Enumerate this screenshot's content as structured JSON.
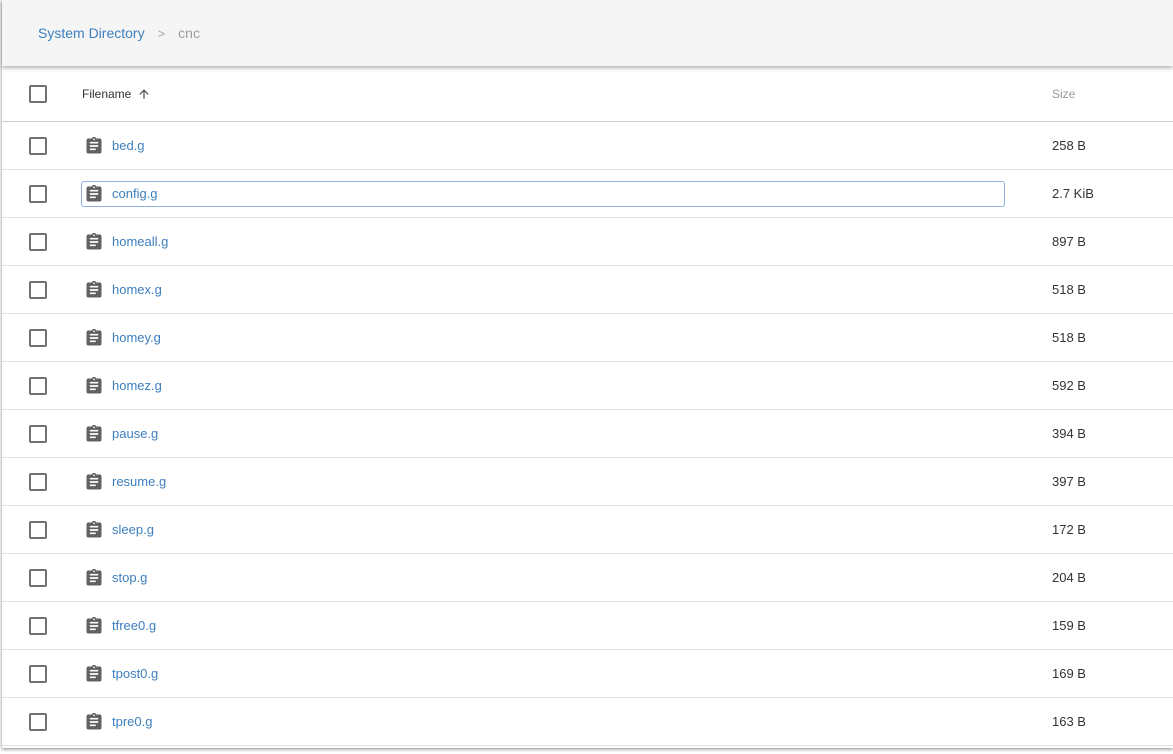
{
  "breadcrumb": {
    "root": "System Directory",
    "separator": ">",
    "current": "cnc"
  },
  "table": {
    "columns": {
      "filename": "Filename",
      "size": "Size"
    },
    "sort": {
      "column": "Filename",
      "direction": "ascending"
    },
    "focused_row": 1,
    "rows": [
      {
        "name": "bed.g",
        "size": "258 B"
      },
      {
        "name": "config.g",
        "size": "2.7 KiB"
      },
      {
        "name": "homeall.g",
        "size": "897 B"
      },
      {
        "name": "homex.g",
        "size": "518 B"
      },
      {
        "name": "homey.g",
        "size": "518 B"
      },
      {
        "name": "homez.g",
        "size": "592 B"
      },
      {
        "name": "pause.g",
        "size": "394 B"
      },
      {
        "name": "resume.g",
        "size": "397 B"
      },
      {
        "name": "sleep.g",
        "size": "172 B"
      },
      {
        "name": "stop.g",
        "size": "204 B"
      },
      {
        "name": "tfree0.g",
        "size": "159 B"
      },
      {
        "name": "tpost0.g",
        "size": "169 B"
      },
      {
        "name": "tpre0.g",
        "size": "163 B"
      }
    ]
  },
  "colors": {
    "link": "#3d7fbf",
    "icon": "#616161",
    "header_bg": "#f5f5f5"
  }
}
